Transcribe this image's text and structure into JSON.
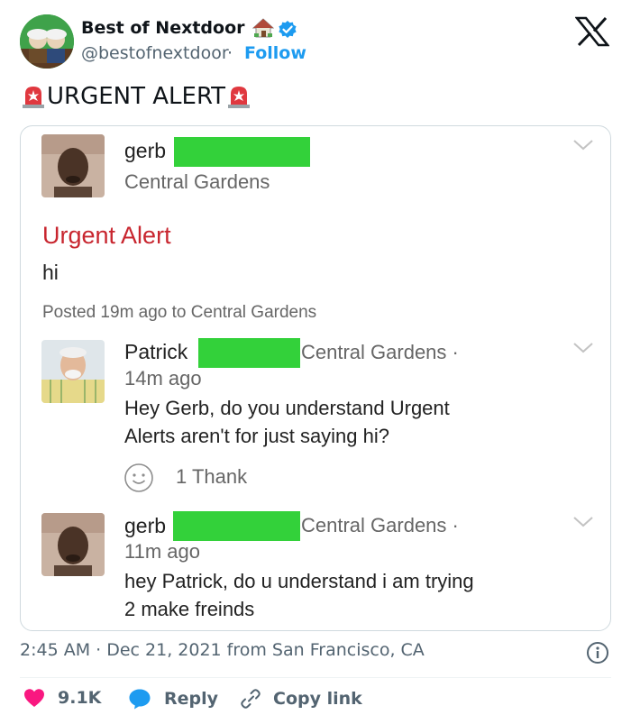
{
  "tweet": {
    "author_name": "Best of Nextdoor",
    "author_handle": "@bestofnextdoor",
    "handle_separator": "·",
    "follow_label": "Follow",
    "text": "URGENT ALERT",
    "icons": [
      "avatar",
      "house-emoji-icon",
      "verified-badge-icon",
      "x-logo-icon",
      "siren-emoji-icon"
    ]
  },
  "post": {
    "author": "gerb",
    "neighborhood": "Central Gardens",
    "title": "Urgent Alert",
    "body": "hi",
    "posted_line": "Posted 19m ago to Central Gardens",
    "title_color": "#c8262f",
    "redaction_color": "#33d13a"
  },
  "comments": [
    {
      "author": "Patrick",
      "neighborhood": "Central Gardens ·",
      "time": "14m ago",
      "lines": [
        "Hey Gerb, do you understand Urgent",
        "Alerts aren't for just saying hi?"
      ],
      "thanks": "1 Thank"
    },
    {
      "author": "gerb",
      "neighborhood": "Central Gardens ·",
      "time": "11m ago",
      "lines": [
        "hey Patrick, do u understand i am trying",
        "2 make freinds"
      ]
    }
  ],
  "footer": {
    "timestamp": "2:45 AM · Dec 21, 2021 from San Francisco, CA",
    "likes": "9.1K",
    "reply_label": "Reply",
    "copy_link_label": "Copy link",
    "like_color": "#f91880",
    "accent_color": "#1d9bf0"
  }
}
